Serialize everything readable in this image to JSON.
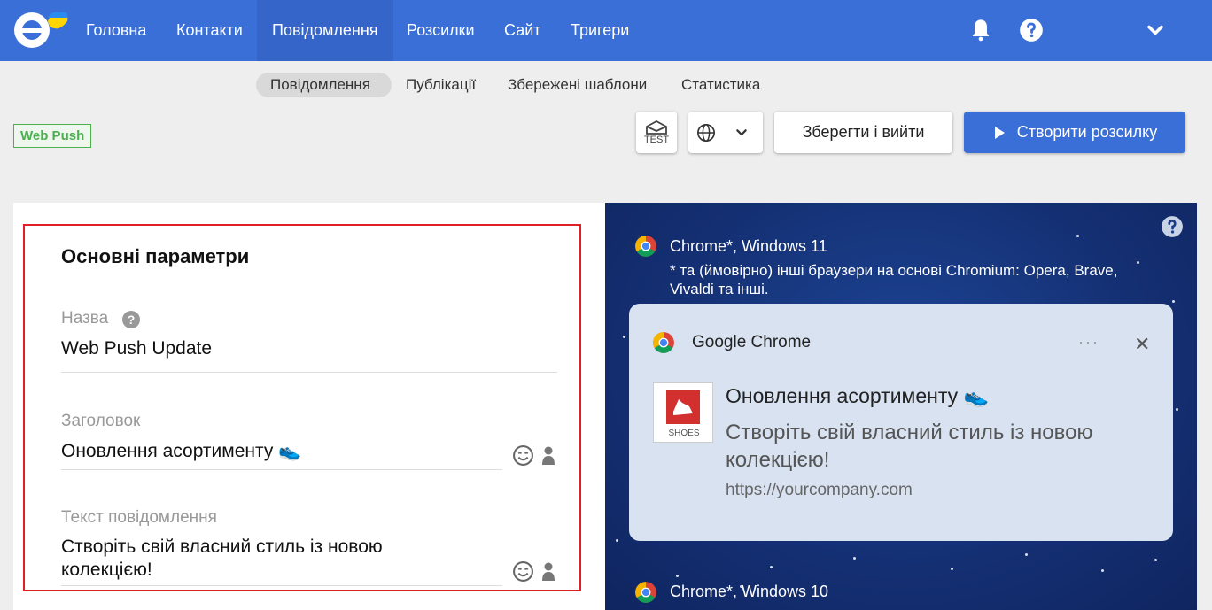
{
  "nav": {
    "items": [
      "Головна",
      "Контакти",
      "Повідомлення",
      "Розсилки",
      "Сайт",
      "Тригери"
    ],
    "active_index": 2
  },
  "subnav": {
    "tabs": [
      "Повідомлення",
      "Публікації",
      "Збережені шаблони",
      "Статистика"
    ],
    "active_index": 0
  },
  "badge": "Web Push",
  "toolbar": {
    "test_label": "TEST",
    "save_exit": "Зберегти і вийти",
    "create_campaign": "Створити розсилку"
  },
  "form": {
    "section_title": "Основні параметри",
    "name_label": "Назва",
    "name_value": "Web Push Update",
    "title_label": "Заголовок",
    "title_value": "Оновлення асортименту 👟",
    "text_label": "Текст повідомлення",
    "text_value_line1": "Створіть свій власний стиль із новою",
    "text_value_line2": "колекцією!"
  },
  "preview": {
    "help": "?",
    "browser1": "Chrome*, Windows 11",
    "note_line1": "* та (ймовірно) інші браузери на основі Chromium: Opera, Brave,",
    "note_line2": "Vivaldi та інші.",
    "card": {
      "app": "Google Chrome",
      "dots": "···",
      "close": "✕",
      "image_text": "SHOES",
      "title": "Оновлення асортименту 👟",
      "body": "Створіть свій власний стиль із новою колекцією!",
      "url": "https://yourcompany.com"
    },
    "browser2": "Chrome*, Windows 10"
  },
  "colors": {
    "brand": "#3a6fd8",
    "highlight": "#e01f26",
    "badge": "#4caf50"
  }
}
